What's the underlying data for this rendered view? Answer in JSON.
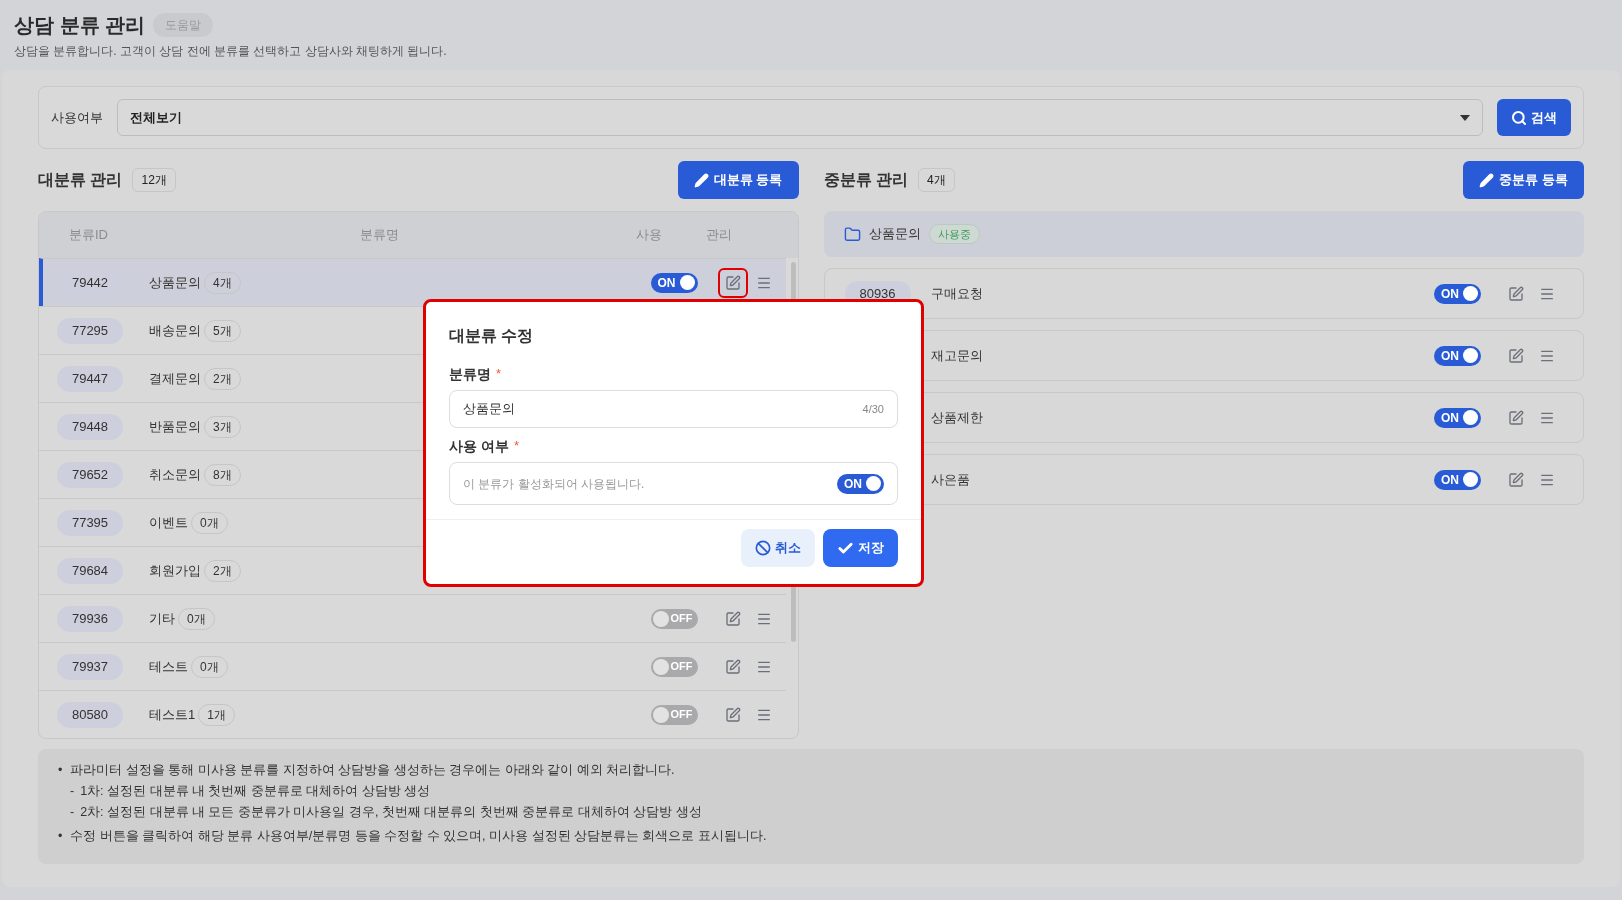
{
  "page": {
    "title": "상담 분류 관리",
    "help": "도움말",
    "subtitle": "상담을 분류합니다. 고객이 상담 전에 분류를 선택하고 상담사와 채팅하게 됩니다."
  },
  "filter": {
    "label": "사용여부",
    "value": "전체보기",
    "search_button": "검색"
  },
  "major": {
    "title": "대분류 관리",
    "count": "12개",
    "add_button": "대분류 등록",
    "columns": [
      "분류ID",
      "분류명",
      "사용",
      "관리"
    ],
    "rows": [
      {
        "id": "79442",
        "name": "상품문의",
        "count": "4개",
        "on": true,
        "switch_text": "ON",
        "selected": true,
        "edit_highlighted": true
      },
      {
        "id": "77295",
        "name": "배송문의",
        "count": "5개",
        "selected": false
      },
      {
        "id": "79447",
        "name": "결제문의",
        "count": "2개",
        "selected": false
      },
      {
        "id": "79448",
        "name": "반품문의",
        "count": "3개",
        "selected": false
      },
      {
        "id": "79652",
        "name": "취소문의",
        "count": "8개",
        "selected": false
      },
      {
        "id": "77395",
        "name": "이벤트",
        "count": "0개",
        "selected": false
      },
      {
        "id": "79684",
        "name": "회원가입",
        "count": "2개",
        "selected": false
      },
      {
        "id": "79936",
        "name": "기타",
        "count": "0개",
        "on": false,
        "switch_text": "OFF",
        "selected": false,
        "edit_highlighted": false
      },
      {
        "id": "79937",
        "name": "테스트",
        "count": "0개",
        "on": false,
        "switch_text": "OFF",
        "selected": false,
        "edit_highlighted": false
      },
      {
        "id": "80580",
        "name": "테스트1",
        "count": "1개",
        "on": false,
        "switch_text": "OFF",
        "selected": false,
        "edit_highlighted": false
      }
    ]
  },
  "middle": {
    "title": "중분류 관리",
    "count": "4개",
    "add_button": "중분류 등록",
    "parent": {
      "name": "상품문의",
      "status": "사용중"
    },
    "rows": [
      {
        "id": "80936",
        "name": "구매요청",
        "on": true,
        "switch_text": "ON"
      },
      {
        "name": "재고문의",
        "on": true,
        "switch_text": "ON"
      },
      {
        "name": "상품제한",
        "on": true,
        "switch_text": "ON"
      },
      {
        "name": "사은품",
        "on": true,
        "switch_text": "ON"
      }
    ]
  },
  "notes": [
    {
      "marker": "•",
      "text": "파라미터 설정을 통해 미사용 분류를 지정하여 상담방을 생성하는 경우에는 아래와 같이 예외 처리합니다.",
      "children": [
        {
          "marker": "-",
          "text": "1차: 설정된 대분류 내 첫번째 중분류로 대체하여 상담방 생성"
        },
        {
          "marker": "-",
          "text": "2차: 설정된 대분류 내 모든 중분류가 미사용일 경우, 첫번째 대분류의 첫번째 중분류로 대체하여 상담방 생성"
        }
      ]
    },
    {
      "marker": "•",
      "text": "수정 버튼을 클릭하여 해당 분류 사용여부/분류명 등을 수정할 수 있으며, 미사용 설정된 상담분류는 회색으로 표시됩니다."
    }
  ],
  "dialog": {
    "title": "대분류 수정",
    "highlighted": true,
    "fields": [
      {
        "kind": "text",
        "label": "분류명",
        "mark": "*",
        "value": "상품문의",
        "counter": "4/30"
      },
      {
        "kind": "toggle",
        "label": "사용 여부",
        "mark": "*",
        "hint": "이 분류가 활성화되어 사용됩니다.",
        "on": true,
        "switch_text": "ON"
      }
    ],
    "buttons": [
      {
        "kind": "cancel",
        "label": "취소"
      },
      {
        "kind": "save",
        "label": "저장"
      }
    ]
  }
}
